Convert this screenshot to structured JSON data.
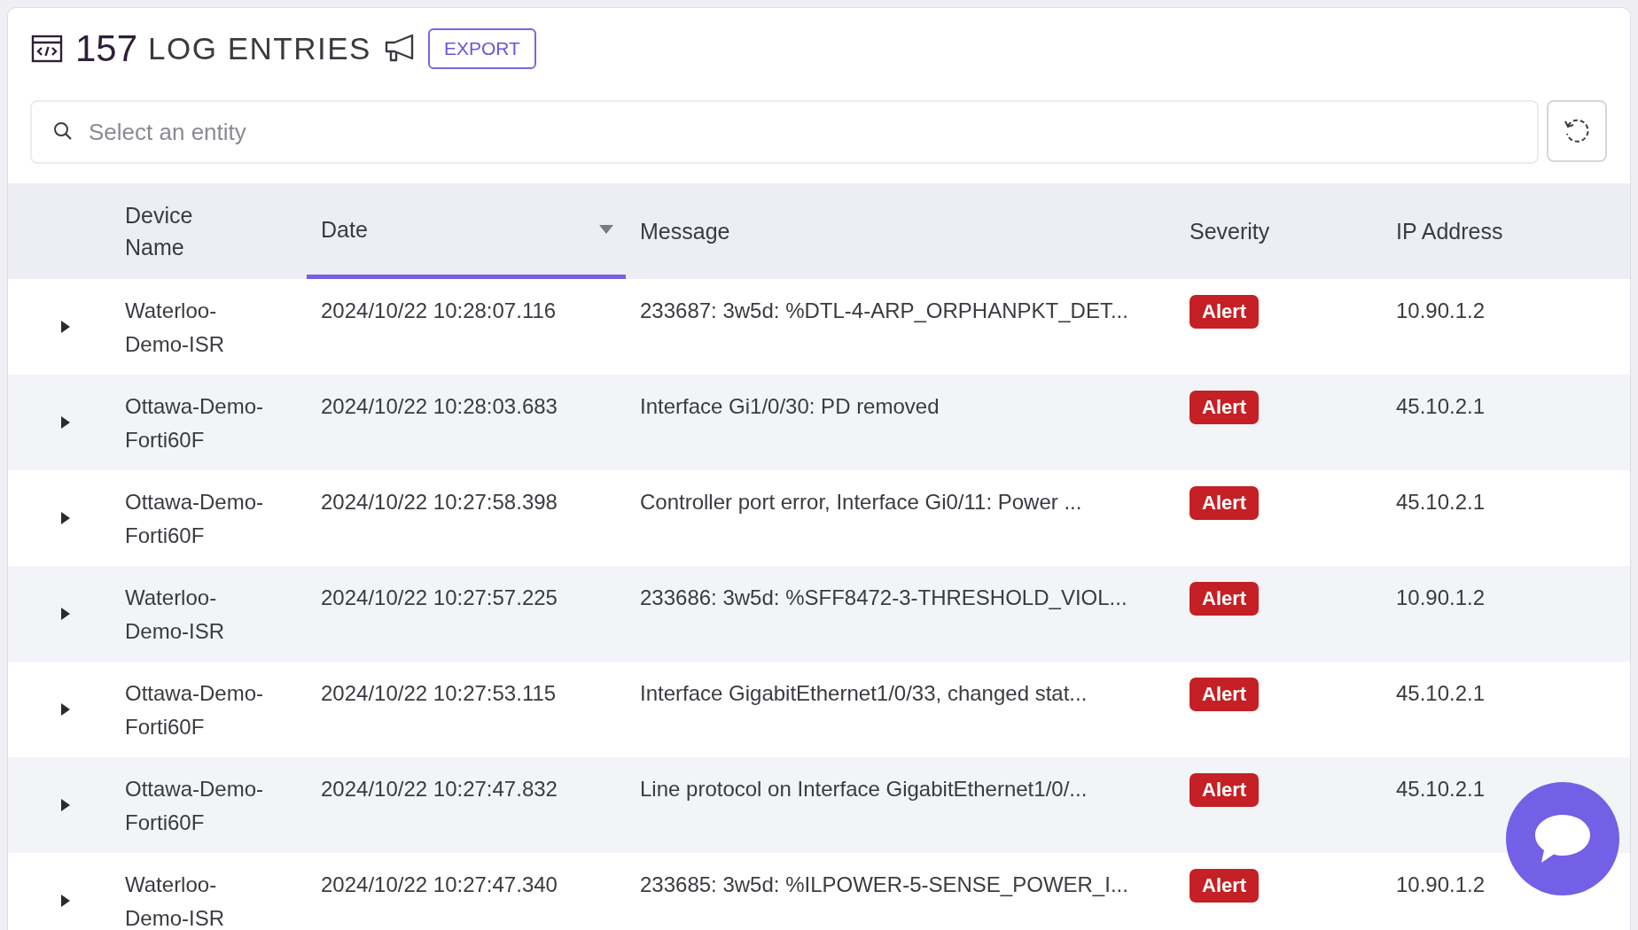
{
  "header": {
    "count": "157",
    "title": "LOG ENTRIES",
    "export_button": "EXPORT"
  },
  "search": {
    "placeholder": "Select an entity"
  },
  "table": {
    "columns": [
      {
        "label": "Device Name",
        "sorted": false
      },
      {
        "label": "Date",
        "sorted": true
      },
      {
        "label": "Message",
        "sorted": false
      },
      {
        "label": "Severity",
        "sorted": false
      },
      {
        "label": "IP Address",
        "sorted": false
      }
    ],
    "rows": [
      {
        "expanded": false,
        "device": "Waterloo-Demo-ISR",
        "date": "2024/10/22 10:28:07.116",
        "message": "233687: 3w5d: %DTL-4-ARP_ORPHANPKT_DET...",
        "severity": "Alert",
        "ip": "10.90.1.2"
      },
      {
        "expanded": false,
        "device": "Ottawa-Demo-Forti60F",
        "date": "2024/10/22 10:28:03.683",
        "message": "Interface Gi1/0/30: PD removed",
        "severity": "Alert",
        "ip": "45.10.2.1"
      },
      {
        "expanded": false,
        "device": "Ottawa-Demo-Forti60F",
        "date": "2024/10/22 10:27:58.398",
        "message": "Controller port error, Interface Gi0/11: Power ...",
        "severity": "Alert",
        "ip": "45.10.2.1"
      },
      {
        "expanded": false,
        "device": "Waterloo-Demo-ISR",
        "date": "2024/10/22 10:27:57.225",
        "message": "233686: 3w5d: %SFF8472-3-THRESHOLD_VIOL...",
        "severity": "Alert",
        "ip": "10.90.1.2"
      },
      {
        "expanded": false,
        "device": "Ottawa-Demo-Forti60F",
        "date": "2024/10/22 10:27:53.115",
        "message": "Interface GigabitEthernet1/0/33, changed stat...",
        "severity": "Alert",
        "ip": "45.10.2.1"
      },
      {
        "expanded": false,
        "device": "Ottawa-Demo-Forti60F",
        "date": "2024/10/22 10:27:47.832",
        "message": "Line protocol on Interface GigabitEthernet1/0/...",
        "severity": "Alert",
        "ip": "45.10.2.1"
      },
      {
        "expanded": false,
        "device": "Waterloo-Demo-ISR",
        "date": "2024/10/22 10:27:47.340",
        "message": "233685: 3w5d: %ILPOWER-5-SENSE_POWER_I...",
        "severity": "Alert",
        "ip": "10.90.1.2"
      }
    ]
  }
}
